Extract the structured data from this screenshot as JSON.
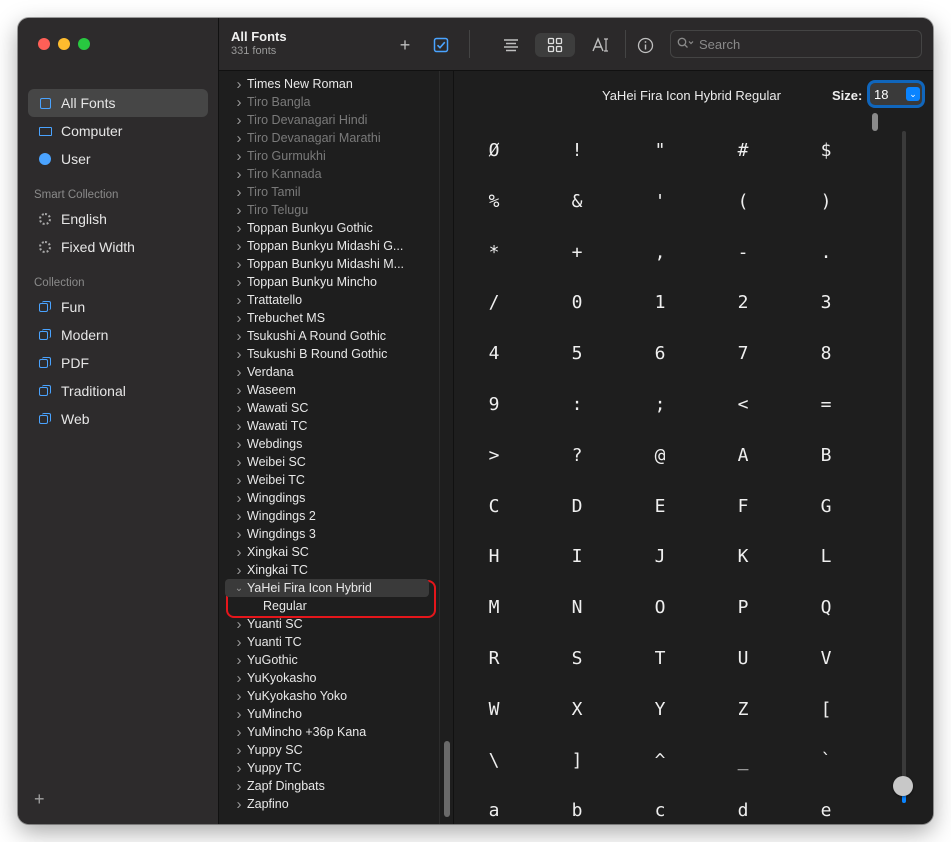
{
  "sidebar": {
    "items": [
      {
        "label": "All Fonts",
        "icon": "font-book-icon"
      },
      {
        "label": "Computer",
        "icon": "computer-icon"
      },
      {
        "label": "User",
        "icon": "user-icon"
      }
    ],
    "smart_collection_header": "Smart Collection",
    "smart_collections": [
      {
        "label": "English",
        "icon": "gear-icon"
      },
      {
        "label": "Fixed Width",
        "icon": "gear-icon"
      }
    ],
    "collection_header": "Collection",
    "collections": [
      {
        "label": "Fun",
        "icon": "collection-icon"
      },
      {
        "label": "Modern",
        "icon": "collection-icon"
      },
      {
        "label": "PDF",
        "icon": "collection-icon"
      },
      {
        "label": "Traditional",
        "icon": "collection-icon"
      },
      {
        "label": "Web",
        "icon": "collection-icon"
      }
    ],
    "add_label": "+"
  },
  "toolbar": {
    "title": "All Fonts",
    "subtitle": "331 fonts",
    "add_label": "+",
    "search_placeholder": "Search"
  },
  "font_list": [
    {
      "name": "Times New Roman",
      "dim": false
    },
    {
      "name": "Tiro Bangla",
      "dim": true
    },
    {
      "name": "Tiro Devanagari Hindi",
      "dim": true
    },
    {
      "name": "Tiro Devanagari Marathi",
      "dim": true
    },
    {
      "name": "Tiro Gurmukhi",
      "dim": true
    },
    {
      "name": "Tiro Kannada",
      "dim": true
    },
    {
      "name": "Tiro Tamil",
      "dim": true
    },
    {
      "name": "Tiro Telugu",
      "dim": true
    },
    {
      "name": "Toppan Bunkyu Gothic",
      "dim": false
    },
    {
      "name": "Toppan Bunkyu Midashi G...",
      "dim": false
    },
    {
      "name": "Toppan Bunkyu Midashi M...",
      "dim": false
    },
    {
      "name": "Toppan Bunkyu Mincho",
      "dim": false
    },
    {
      "name": "Trattatello",
      "dim": false
    },
    {
      "name": "Trebuchet MS",
      "dim": false
    },
    {
      "name": "Tsukushi A Round Gothic",
      "dim": false
    },
    {
      "name": "Tsukushi B Round Gothic",
      "dim": false
    },
    {
      "name": "Verdana",
      "dim": false
    },
    {
      "name": "Waseem",
      "dim": false
    },
    {
      "name": "Wawati SC",
      "dim": false
    },
    {
      "name": "Wawati TC",
      "dim": false
    },
    {
      "name": "Webdings",
      "dim": false
    },
    {
      "name": "Weibei SC",
      "dim": false
    },
    {
      "name": "Weibei TC",
      "dim": false
    },
    {
      "name": "Wingdings",
      "dim": false
    },
    {
      "name": "Wingdings 2",
      "dim": false
    },
    {
      "name": "Wingdings 3",
      "dim": false
    },
    {
      "name": "Xingkai SC",
      "dim": false
    },
    {
      "name": "Xingkai TC",
      "dim": false
    },
    {
      "name": "YaHei Fira Icon Hybrid",
      "dim": false,
      "expanded": true
    },
    {
      "name": "Regular",
      "dim": false,
      "sub": true
    },
    {
      "name": "Yuanti SC",
      "dim": false
    },
    {
      "name": "Yuanti TC",
      "dim": false
    },
    {
      "name": "YuGothic",
      "dim": false
    },
    {
      "name": "YuKyokasho",
      "dim": false
    },
    {
      "name": "YuKyokasho Yoko",
      "dim": false
    },
    {
      "name": "YuMincho",
      "dim": false
    },
    {
      "name": "YuMincho +36p Kana",
      "dim": false
    },
    {
      "name": "Yuppy SC",
      "dim": false
    },
    {
      "name": "Yuppy TC",
      "dim": false
    },
    {
      "name": "Zapf Dingbats",
      "dim": false
    },
    {
      "name": "Zapfino",
      "dim": false
    }
  ],
  "preview": {
    "font_title": "YaHei Fira Icon Hybrid Regular",
    "size_label": "Size:",
    "size_value": "18",
    "glyphs": [
      "Ø",
      "!",
      "\"",
      "#",
      "$",
      "%",
      "&",
      "'",
      "(",
      ")",
      "*",
      "+",
      ",",
      "-",
      ".",
      "/",
      "0",
      "1",
      "2",
      "3",
      "4",
      "5",
      "6",
      "7",
      "8",
      "9",
      ":",
      ";",
      "<",
      "=",
      ">",
      "?",
      "@",
      "A",
      "B",
      "C",
      "D",
      "E",
      "F",
      "G",
      "H",
      "I",
      "J",
      "K",
      "L",
      "M",
      "N",
      "O",
      "P",
      "Q",
      "R",
      "S",
      "T",
      "U",
      "V",
      "W",
      "X",
      "Y",
      "Z",
      "[",
      "\\",
      "]",
      "^",
      "_",
      "`",
      "a",
      "b",
      "c",
      "d",
      "e"
    ]
  },
  "colors": {
    "accent": "#0a84ff",
    "annotation": "#e5161b"
  }
}
